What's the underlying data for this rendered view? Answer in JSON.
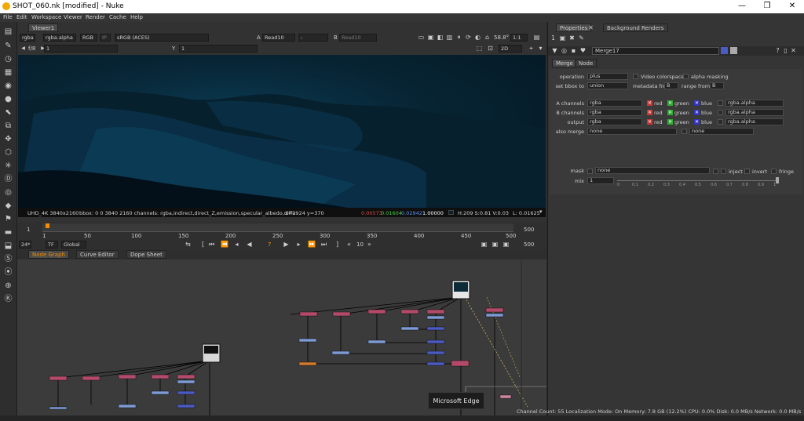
{
  "window": {
    "title": "SHOT_060.nk [modified] - Nuke",
    "minimize": "—",
    "maximize": "❐",
    "close": "✕"
  },
  "menu": [
    "File",
    "Edit",
    "Workspace",
    "Viewer",
    "Render",
    "Cache",
    "Help"
  ],
  "viewer": {
    "tab": "Viewer1",
    "channels": "rgba",
    "alpha": "rgba.alpha",
    "display_channel": "RGB",
    "ip": "IP",
    "colorspace": "sRGB (ACES)",
    "a_label": "A",
    "a_input": "Read10",
    "compare": "-",
    "b_label": "B",
    "b_input": "Read10",
    "fstop": "58.8°",
    "zoom": "1:1",
    "frame_ratio": "f/8",
    "frame_lock": "1",
    "y_label": "Y",
    "y_value": "1",
    "view_mode": "2D",
    "info_format": "UHD_4K 3840x2160",
    "info_bbox": "bbox: 0 0 3840 2160 channels: rgba,indirect,direct_Z,emission,specular_albedo,diffu",
    "info_coords": "x=2924 y=370",
    "info_r": "0.00573",
    "info_g": "0.01604",
    "info_b": "0.02942",
    "info_a": "1.00000",
    "info_hsv": "H:209 S:0.81 V:0.03",
    "info_l": "L: 0.01625"
  },
  "timeline": {
    "start": "1",
    "end": "500",
    "ticks": [
      "1",
      "50",
      "100",
      "150",
      "200",
      "250",
      "300",
      "350",
      "400",
      "450",
      "500"
    ],
    "fps": "24*",
    "tf": "TF",
    "range": "Global",
    "current_frame": "7",
    "step": "10",
    "end_right": "500"
  },
  "nodegraph": {
    "tabs": [
      "Node Graph",
      "Curve Editor",
      "Dope Sheet"
    ],
    "tooltip": "Microsoft Edge"
  },
  "properties": {
    "tabs": [
      "Properties",
      "Background Renders"
    ],
    "node_name": "Merge17",
    "subtabs": [
      "Merge",
      "Node"
    ],
    "operation_label": "operation",
    "operation": "plus",
    "video_colorspace": "Video colorspace",
    "alpha_masking": "alpha masking",
    "set_bbox_label": "set bbox to",
    "set_bbox": "union",
    "metadata_label": "metadata from",
    "metadata": "B",
    "range_label": "range from",
    "range": "B",
    "a_channels_label": "A channels",
    "a_channels": "rgba",
    "b_channels_label": "B channels",
    "b_channels": "rgba",
    "output_label": "output",
    "output": "rgba",
    "also_merge_label": "also merge",
    "also_merge": "none",
    "also_merge2": "none",
    "red": "red",
    "green": "green",
    "blue": "blue",
    "alpha_chan": "rgba.alpha",
    "mask_label": "mask",
    "mask": "none",
    "inject": "inject",
    "invert": "invert",
    "fringe": "fringe",
    "mix_label": "mix",
    "mix": "1",
    "mix_ticks": [
      "0",
      "0.1",
      "0.2",
      "0.3",
      "0.4",
      "0.5",
      "0.6",
      "0.7",
      "0.8",
      "0.9",
      "1"
    ]
  },
  "status": {
    "text": "Channel Count: 55 Localization Mode: On Memory: 7.8 GB (12.2%) CPU: 0.0% Disk: 0.0 MB/s Network: 0.0 MB/s"
  },
  "colors": {
    "pink_node": "#b34a6a",
    "blue_node": "#7f9bd6",
    "dark_blue_node": "#4b5bc4",
    "orange_node": "#d67a2b",
    "accent": "#f28c00"
  }
}
